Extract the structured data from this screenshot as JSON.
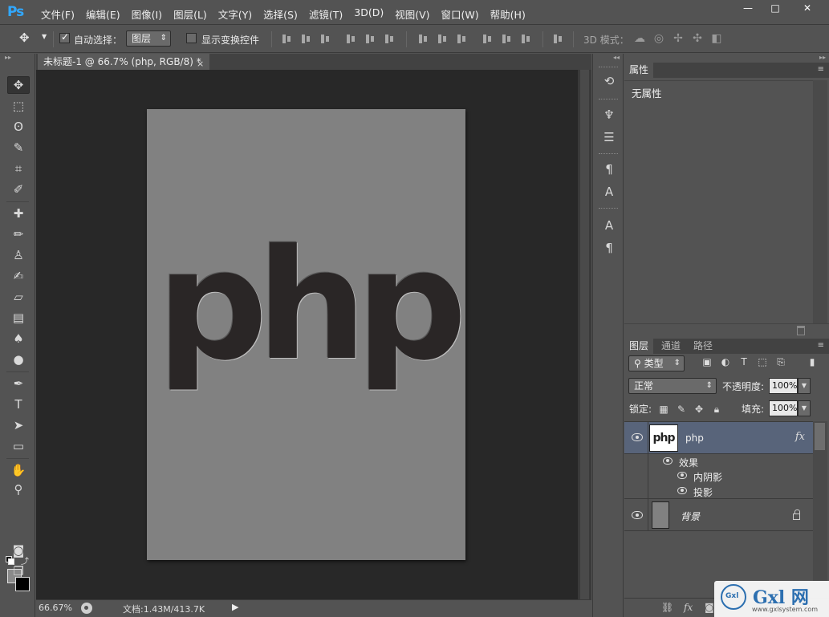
{
  "app": {
    "logo": "Ps",
    "menus": [
      "文件(F)",
      "编辑(E)",
      "图像(I)",
      "图层(L)",
      "文字(Y)",
      "选择(S)",
      "滤镜(T)",
      "3D(D)",
      "视图(V)",
      "窗口(W)",
      "帮助(H)"
    ],
    "window_controls": {
      "minimize": "—",
      "restore": "□",
      "close": "✕"
    }
  },
  "options": {
    "auto_select_label": "自动选择：",
    "auto_select_checked": true,
    "auto_select_target": "图层",
    "show_transform_label": "显示变换控件",
    "show_transform_checked": false,
    "threed_mode_label": "3D 模式："
  },
  "document": {
    "tab_title": "未标题-1 @ 66.7% (php, RGB/8) *",
    "tab_close": "×",
    "canvas_text": "php",
    "background_color": "#818181",
    "text_color": "#2a2626"
  },
  "status": {
    "zoom": "66.67%",
    "doc_size": "文档:1.43M/413.7K",
    "arrow": "▶"
  },
  "tools": [
    {
      "name": "move-tool-icon",
      "glyph": "✥"
    },
    {
      "name": "marquee-tool-icon",
      "glyph": "⬚"
    },
    {
      "name": "lasso-tool-icon",
      "glyph": "ʘ"
    },
    {
      "name": "quick-select-tool-icon",
      "glyph": "✎"
    },
    {
      "name": "crop-tool-icon",
      "glyph": "⌗"
    },
    {
      "name": "eyedropper-tool-icon",
      "glyph": "✐"
    },
    {
      "name": "healing-brush-tool-icon",
      "glyph": "✚"
    },
    {
      "name": "brush-tool-icon",
      "glyph": "✏"
    },
    {
      "name": "stamp-tool-icon",
      "glyph": "♙"
    },
    {
      "name": "history-brush-tool-icon",
      "glyph": "✍"
    },
    {
      "name": "eraser-tool-icon",
      "glyph": "▱"
    },
    {
      "name": "gradient-tool-icon",
      "glyph": "▤"
    },
    {
      "name": "blur-tool-icon",
      "glyph": "♠"
    },
    {
      "name": "dodge-tool-icon",
      "glyph": "●"
    },
    {
      "name": "pen-tool-icon",
      "glyph": "✒"
    },
    {
      "name": "type-tool-icon",
      "glyph": "T"
    },
    {
      "name": "path-select-tool-icon",
      "glyph": "➤"
    },
    {
      "name": "shape-tool-icon",
      "glyph": "▭"
    },
    {
      "name": "hand-tool-icon",
      "glyph": "✋"
    },
    {
      "name": "zoom-tool-icon",
      "glyph": "⚲"
    },
    {
      "name": "quick-mask-icon",
      "glyph": "◙"
    },
    {
      "name": "screen-mode-icon",
      "glyph": "❐"
    }
  ],
  "dock_icons": [
    {
      "name": "history-icon",
      "glyph": "⟲"
    },
    {
      "name": "brush-presets-icon",
      "glyph": "♆"
    },
    {
      "name": "brush-settings-icon",
      "glyph": "☰"
    },
    {
      "name": "paragraph-styles-icon",
      "glyph": "¶"
    },
    {
      "name": "character-styles-icon",
      "glyph": "A"
    },
    {
      "name": "character-icon",
      "glyph": "A"
    },
    {
      "name": "paragraph-icon",
      "glyph": "¶"
    }
  ],
  "properties": {
    "tab": "属性",
    "content": "无属性"
  },
  "layers": {
    "tabs": [
      "图层",
      "通道",
      "路径"
    ],
    "filter_kind": "类型",
    "blend_mode": "正常",
    "opacity_label": "不透明度:",
    "opacity": "100%",
    "lock_label": "锁定:",
    "fill_label": "填充:",
    "fill": "100%",
    "items": [
      {
        "name": "php",
        "thumb_text": "php",
        "fx": "fx",
        "effects_label": "效果",
        "effects": [
          "内阴影",
          "投影"
        ]
      },
      {
        "name": "背景"
      }
    ],
    "footer_fx": "fx"
  },
  "watermark": {
    "logo_text": "Gxl",
    "title": "Gxl 网",
    "url": "www.gxlsystem.com"
  }
}
